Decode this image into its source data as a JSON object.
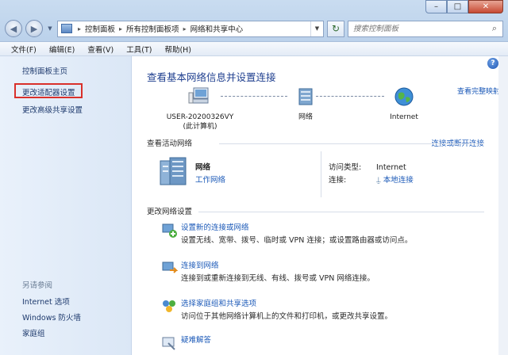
{
  "window": {
    "caption": {
      "minimize": "–",
      "maximize": "□",
      "close": "✕"
    }
  },
  "nav": {
    "back_icon": "back-arrow-icon",
    "forward_icon": "forward-arrow-icon",
    "breadcrumbs": [
      "控制面板",
      "所有控制面板项",
      "网络和共享中心"
    ],
    "refresh_glyph": "↻",
    "search_placeholder": "搜索控制面板"
  },
  "menu": [
    "文件(F)",
    "编辑(E)",
    "查看(V)",
    "工具(T)",
    "帮助(H)"
  ],
  "sidebar": {
    "home": "控制面板主页",
    "adapter_settings": "更改适配器设置",
    "advanced_sharing": "更改高级共享设置",
    "see_also_title": "另请参阅",
    "see_also": [
      "Internet 选项",
      "Windows 防火墙",
      "家庭组"
    ],
    "highlight_color": "#d9302b"
  },
  "main": {
    "help_glyph": "?",
    "title": "查看基本网络信息并设置连接",
    "view_full_map": "查看完整映射",
    "map": {
      "computer_name": "USER-20200326VY",
      "computer_sub": "(此计算机)",
      "network": "网络",
      "internet": "Internet"
    },
    "active": {
      "title": "查看活动网络",
      "connect_link": "连接或断开连接",
      "network_name": "网络",
      "network_type": "工作网络",
      "access_type_label": "访问类型:",
      "access_type_value": "Internet",
      "connections_label": "连接:",
      "connections_value": "本地连接"
    },
    "change": {
      "title": "更改网络设置",
      "tasks": [
        {
          "link": "设置新的连接或网络",
          "desc": "设置无线、宽带、拨号、临时或 VPN 连接；或设置路由器或访问点。"
        },
        {
          "link": "连接到网络",
          "desc": "连接到或重新连接到无线、有线、拨号或 VPN 网络连接。"
        },
        {
          "link": "选择家庭组和共享选项",
          "desc": "访问位于其他网络计算机上的文件和打印机，或更改共享设置。"
        },
        {
          "link": "疑难解答",
          "desc": ""
        }
      ]
    }
  },
  "colors": {
    "link": "#1c5ab8",
    "title": "#1f3f8f"
  }
}
